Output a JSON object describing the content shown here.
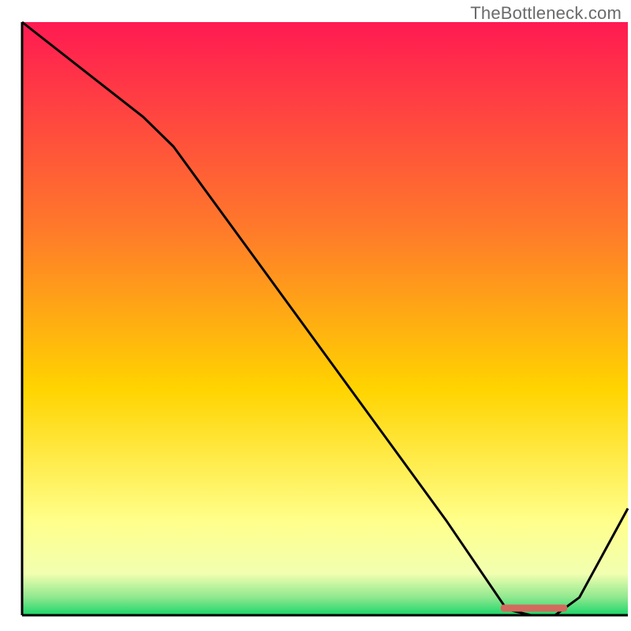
{
  "watermark": "TheBottleneck.com",
  "colors": {
    "gradient_top": "#ff1a52",
    "gradient_mid1": "#ff7a2a",
    "gradient_mid2": "#ffd400",
    "gradient_low": "#ffff8a",
    "gradient_base": "#1bd66a",
    "line": "#000000",
    "marker": "#d46a5e"
  },
  "chart_data": {
    "type": "line",
    "title": "",
    "xlabel": "",
    "ylabel": "",
    "xlim": [
      0,
      100
    ],
    "ylim": [
      0,
      100
    ],
    "grid": false,
    "legend": false,
    "annotations": [
      "TheBottleneck.com"
    ],
    "series": [
      {
        "name": "bottleneck-curve",
        "x": [
          0,
          10,
          20,
          25,
          30,
          40,
          50,
          60,
          70,
          78,
          80,
          84,
          88,
          92,
          100
        ],
        "values": [
          100,
          92,
          84,
          79,
          72,
          58,
          44,
          30,
          16,
          4,
          1,
          0,
          0,
          3,
          18
        ]
      }
    ],
    "marker": {
      "name": "optimal-zone-bar",
      "x_start": 79,
      "x_end": 90,
      "y": 0.6,
      "height": 1.2
    },
    "gradient_stops_pct": [
      {
        "offset": 0,
        "color": "#ff1a52"
      },
      {
        "offset": 35,
        "color": "#ff7a2a"
      },
      {
        "offset": 62,
        "color": "#ffd400"
      },
      {
        "offset": 84,
        "color": "#ffff8a"
      },
      {
        "offset": 93,
        "color": "#f2ffb0"
      },
      {
        "offset": 97,
        "color": "#8fe88f"
      },
      {
        "offset": 100,
        "color": "#1bd66a"
      }
    ]
  }
}
